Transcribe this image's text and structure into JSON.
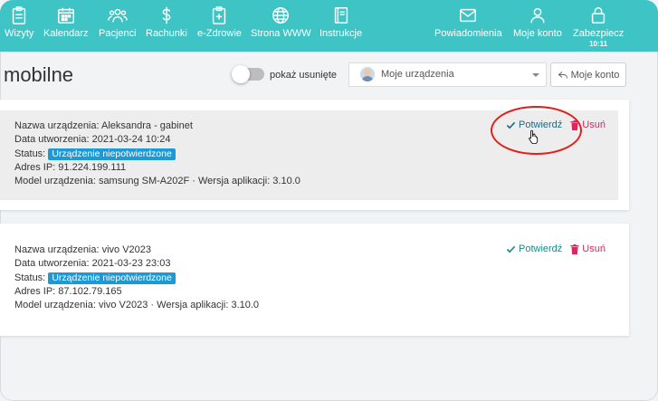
{
  "nav": {
    "items": [
      {
        "label": "Wizyty",
        "icon": "clipboard-icon"
      },
      {
        "label": "Kalendarz",
        "icon": "calendar-icon"
      },
      {
        "label": "Pacjenci",
        "icon": "patients-icon"
      },
      {
        "label": "Rachunki",
        "icon": "dollar-icon"
      },
      {
        "label": "e-Zdrowie",
        "icon": "medical-clipboard-icon"
      },
      {
        "label": "Strona WWW",
        "icon": "globe-icon"
      },
      {
        "label": "Instrukcje",
        "icon": "book-icon"
      }
    ],
    "right_items": [
      {
        "label": "Powiadomienia",
        "icon": "envelope-icon"
      },
      {
        "label": "Moje konto",
        "icon": "user-icon"
      },
      {
        "label": "Zabezpiecz",
        "icon": "lock-icon",
        "time": "10:11"
      }
    ]
  },
  "page": {
    "title": "mobilne",
    "show_deleted_label": "pokaż usunięte",
    "device_select_value": "Moje urządzenia",
    "back_button_label": "Moje konto"
  },
  "devices": [
    {
      "name_line": "Nazwa urządzenia: Aleksandra - gabinet",
      "created_line": "Data utworzenia: 2021-03-24 10:24",
      "status_label": "Status:",
      "status_badge": "Urządzenie niepotwierdzone",
      "ip_line": "Adres IP: 91.224.199.111",
      "model_line": "Model urządzenia: samsung SM-A202F · Wersja aplikacji: 3.10.0",
      "confirm_label": "Potwierdź",
      "delete_label": "Usuń"
    },
    {
      "name_line": "Nazwa urządzenia: vivo V2023",
      "created_line": "Data utworzenia: 2021-03-23 23:03",
      "status_label": "Status:",
      "status_badge": "Urządzenie niepotwierdzone",
      "ip_line": "Adres IP: 87.102.79.165",
      "model_line": "Model urządzenia: vivo V2023 · Wersja aplikacji: 3.10.0",
      "confirm_label": "Potwierdź",
      "delete_label": "Usuń"
    }
  ],
  "colors": {
    "topbar": "#3fc4c5",
    "badge": "#1a9ad6",
    "confirm": "#1a8a8b",
    "delete": "#e0245e",
    "highlight": "#e0201c"
  }
}
